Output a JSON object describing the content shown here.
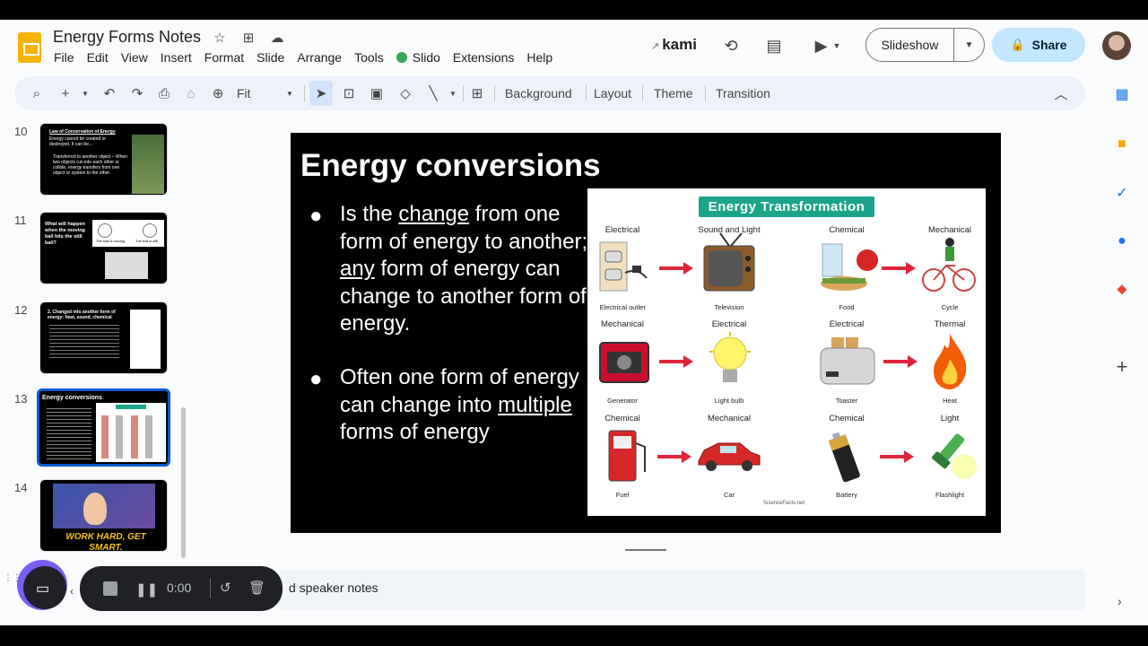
{
  "app": {
    "title": "Energy Forms Notes",
    "menu": [
      "File",
      "Edit",
      "View",
      "Insert",
      "Format",
      "Slide",
      "Arrange",
      "Tools",
      "Slido",
      "Extensions",
      "Help"
    ],
    "kami": "kami",
    "slideshow_label": "Slideshow",
    "share_label": "Share"
  },
  "toolbar": {
    "zoom": "Fit",
    "background": "Background",
    "layout": "Layout",
    "theme": "Theme",
    "transition": "Transition"
  },
  "filmstrip": {
    "numbers": [
      "10",
      "11",
      "12",
      "13",
      "14"
    ],
    "s10": {
      "title": "Law of Conservation of Energy",
      "body": "Energy cannot be created or destroyed. It can be...",
      "b2": "Transferred to another object – When two objects run into each other or collide, energy transfers from one object or system to the other."
    },
    "s11": {
      "title": "What will happen when the moving ball hits the still ball?",
      "c1": "The ball is moving",
      "c2": "The ball is still"
    },
    "s12": {
      "title": "2. Changed into another form of energy: heat, sound, chemical"
    },
    "s13": {
      "title": "Energy conversions"
    },
    "s14": {
      "title": "WORK HARD, GET SMART."
    }
  },
  "slide": {
    "title": "Energy conversions",
    "b1": {
      "p1": "Is the ",
      "u1": "change",
      "p2": " from one form of energy to another; ",
      "u2": "any",
      "p3": " form of energy can change to another form of energy."
    },
    "b2": {
      "p1": "Often one form of energy can change into ",
      "u1": "multiple",
      "p2": " forms of energy"
    },
    "infographic": {
      "title": "Energy Transformation",
      "rows": [
        [
          {
            "from": "Electrical",
            "from_cap": "Electrical outlet",
            "to": "Sound and Light",
            "to_cap": "Television"
          },
          {
            "from": "Chemical",
            "from_cap": "Food",
            "to": "Mechanical",
            "to_cap": "Cycle"
          }
        ],
        [
          {
            "from": "Mechanical",
            "from_cap": "Generator",
            "to": "Electrical",
            "to_cap": "Light bulb"
          },
          {
            "from": "Electrical",
            "from_cap": "Toaster",
            "to": "Thermal",
            "to_cap": "Heat"
          }
        ],
        [
          {
            "from": "Chemical",
            "from_cap": "Fuel",
            "to": "Mechanical",
            "to_cap": "Car"
          },
          {
            "from": "Chemical",
            "from_cap": "Battery",
            "to": "Light",
            "to_cap": "Flashlight"
          }
        ]
      ],
      "credit": "ScienceFacts.net"
    }
  },
  "notes": {
    "placeholder": "d speaker notes"
  },
  "recorder": {
    "time": "0:00"
  },
  "colors": {
    "accent": "#0b57d0",
    "share_bg": "#c2e7ff",
    "infographic_header": "#1aa58a",
    "arrow": "#e0253b"
  }
}
